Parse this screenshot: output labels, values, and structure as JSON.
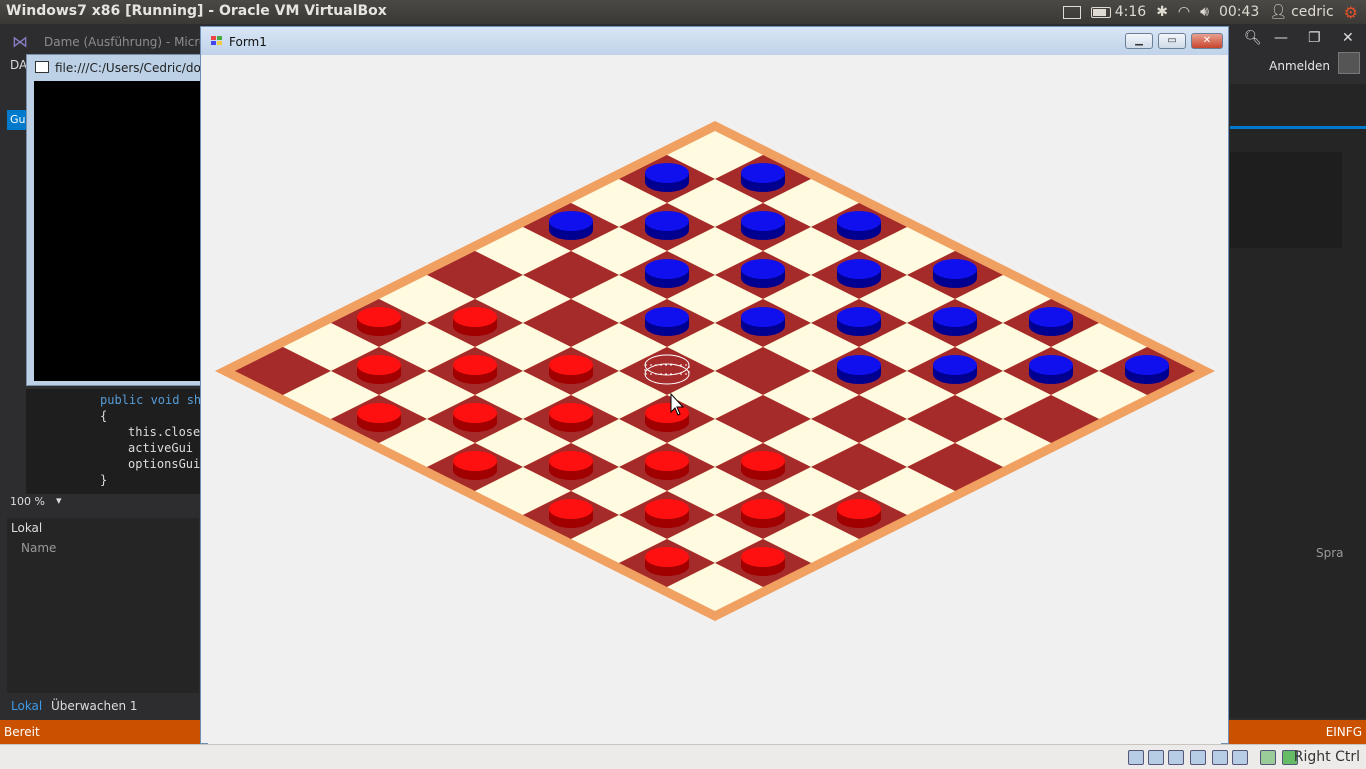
{
  "topbar": {
    "title": "Windows7 x86 [Running] - Oracle VM VirtualBox",
    "battery_time": "4:16",
    "clock": "00:43",
    "user": "cedric"
  },
  "vs": {
    "window_title": "Dame (Ausführung) - Micros",
    "menu_first": "DA",
    "sign_in": "Anmelden",
    "tab_label": "Gu",
    "code_lines": [
      "public void sh",
      "{",
      "this.close",
      "activeGui",
      "optionsGui",
      "}"
    ],
    "zoom": "100 %",
    "locals_title": "Lokal",
    "locals_col_name": "Name",
    "locals_col_lang": "Spra",
    "tab_locals": "Lokal",
    "tab_watch": "Überwachen 1",
    "status_left": "Bereit",
    "status_right": "EINFG"
  },
  "console": {
    "title": "file:///C:/Users/Cedric/doc"
  },
  "form1": {
    "title": "Form1"
  },
  "board": {
    "size": 10,
    "colors": {
      "light": "#fffbe0",
      "dark": "#a52a2a",
      "border": "#f0a060",
      "red_piece": "#ff1010",
      "blue_piece": "#1010ee"
    },
    "pieces": [
      {
        "row": 0,
        "col": 1,
        "color": "blue"
      },
      {
        "row": 0,
        "col": 3,
        "color": "blue"
      },
      {
        "row": 0,
        "col": 5,
        "color": "blue"
      },
      {
        "row": 0,
        "col": 7,
        "color": "blue"
      },
      {
        "row": 0,
        "col": 9,
        "color": "blue"
      },
      {
        "row": 1,
        "col": 0,
        "color": "blue"
      },
      {
        "row": 1,
        "col": 2,
        "color": "blue"
      },
      {
        "row": 1,
        "col": 4,
        "color": "blue"
      },
      {
        "row": 1,
        "col": 6,
        "color": "blue"
      },
      {
        "row": 1,
        "col": 8,
        "color": "blue"
      },
      {
        "row": 2,
        "col": 1,
        "color": "blue"
      },
      {
        "row": 2,
        "col": 3,
        "color": "blue"
      },
      {
        "row": 2,
        "col": 5,
        "color": "blue"
      },
      {
        "row": 2,
        "col": 7,
        "color": "blue"
      },
      {
        "row": 3,
        "col": 0,
        "color": "blue"
      },
      {
        "row": 3,
        "col": 2,
        "color": "blue"
      },
      {
        "row": 3,
        "col": 4,
        "color": "blue"
      },
      {
        "row": 3,
        "col": 6,
        "color": "blue"
      },
      {
        "row": 4,
        "col": 3,
        "color": "blue"
      },
      {
        "row": 5,
        "col": 4,
        "color": "ghost"
      },
      {
        "row": 6,
        "col": 1,
        "color": "red"
      },
      {
        "row": 6,
        "col": 3,
        "color": "red"
      },
      {
        "row": 6,
        "col": 5,
        "color": "red"
      },
      {
        "row": 6,
        "col": 7,
        "color": "red"
      },
      {
        "row": 6,
        "col": 9,
        "color": "red"
      },
      {
        "row": 7,
        "col": 0,
        "color": "red"
      },
      {
        "row": 7,
        "col": 2,
        "color": "red"
      },
      {
        "row": 7,
        "col": 4,
        "color": "red"
      },
      {
        "row": 7,
        "col": 6,
        "color": "red"
      },
      {
        "row": 7,
        "col": 8,
        "color": "red"
      },
      {
        "row": 8,
        "col": 1,
        "color": "red"
      },
      {
        "row": 8,
        "col": 3,
        "color": "red"
      },
      {
        "row": 8,
        "col": 5,
        "color": "red"
      },
      {
        "row": 8,
        "col": 7,
        "color": "red"
      },
      {
        "row": 8,
        "col": 9,
        "color": "red"
      },
      {
        "row": 9,
        "col": 2,
        "color": "red"
      },
      {
        "row": 9,
        "col": 4,
        "color": "red"
      },
      {
        "row": 9,
        "col": 6,
        "color": "red"
      },
      {
        "row": 9,
        "col": 8,
        "color": "red"
      }
    ]
  },
  "vbox_status": {
    "host_key": "Right Ctrl"
  }
}
